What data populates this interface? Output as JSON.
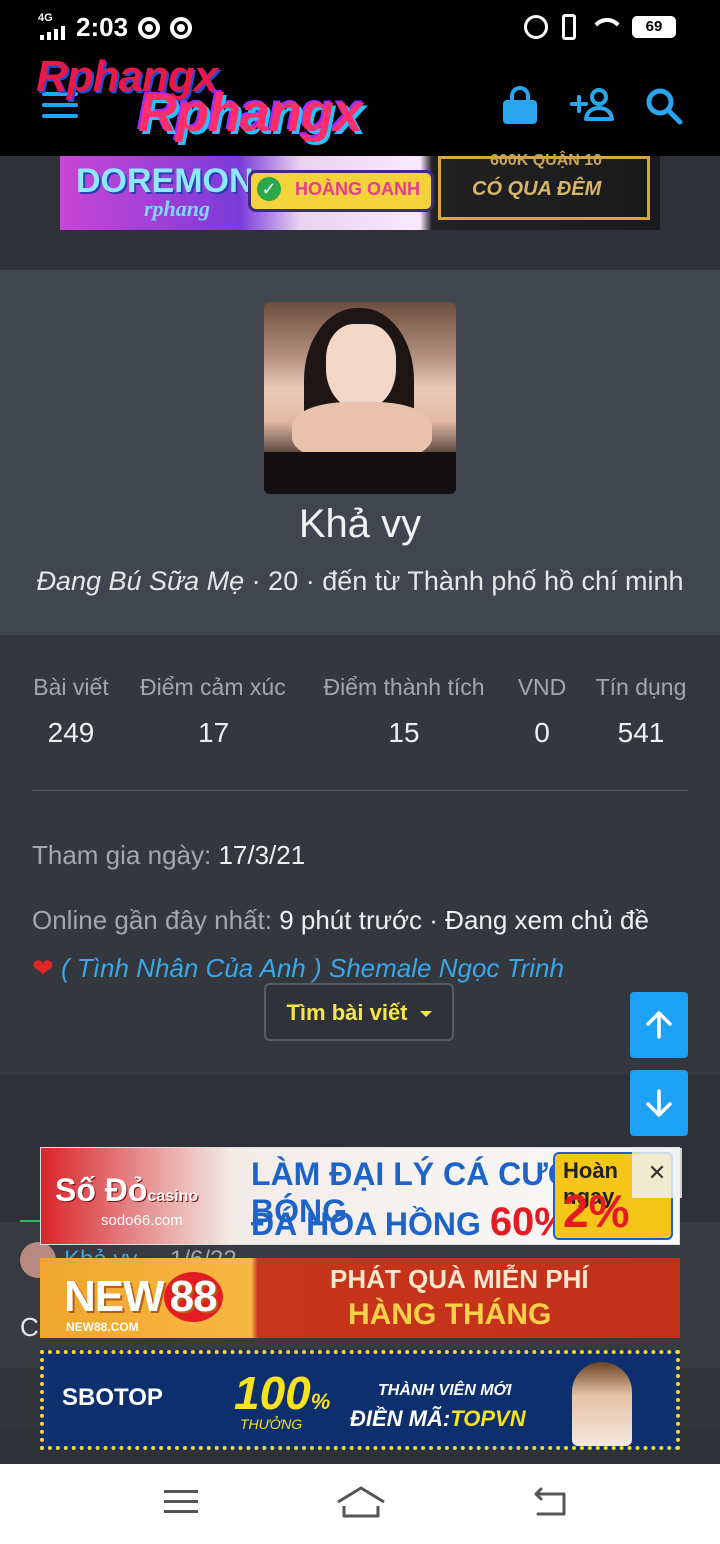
{
  "status_bar": {
    "network": "4G",
    "time": "2:03",
    "battery": "69"
  },
  "header": {
    "logo_text": "Rphangx",
    "logo_suffix": "x"
  },
  "top_banner": {
    "brand": "DOREMON",
    "sub": "rphang",
    "badge": "HOÀNG OANH",
    "line1": "600K QUẬN 10",
    "line2": "CÓ QUA ĐÊM"
  },
  "profile": {
    "name": "Khả vy",
    "title": "Đang Bú Sữa Mẹ",
    "age": "20",
    "location_prefix": "đến từ",
    "location": "Thành phố hồ chí minh"
  },
  "stats": [
    {
      "label": "Bài viết",
      "value": "249"
    },
    {
      "label": "Điểm cảm xúc",
      "value": "17"
    },
    {
      "label": "Điểm thành tích",
      "value": "15"
    },
    {
      "label": "VND",
      "value": "0"
    },
    {
      "label": "Tín dụng",
      "value": "541"
    }
  ],
  "joined": {
    "label": "Tham gia ngày:",
    "value": "17/3/21"
  },
  "last_seen": {
    "label": "Online gần đây nhất:",
    "value": "9 phút trước",
    "activity": "· Đang xem chủ đề",
    "thread_title": "( Tình Nhân Của Anh ) Shemale Ngọc Trinh"
  },
  "find_posts_label": "Tìm bài viết",
  "feed": {
    "author": "Khả vy",
    "date": "1/6/22",
    "snippet": "C"
  },
  "ads": {
    "ad1": {
      "brand": "Số Đỏ",
      "brand_tag": "casino",
      "domain": "sodo66.com",
      "line1": "LÀM ĐẠI LÝ CÁ CƯỢC BÓNG",
      "line2": "ĐÁ HOA HỒNG",
      "pct": "60%",
      "hoan": "Hoàn ngay",
      "hoan_pct": "2%"
    },
    "ad2": {
      "brand": "NEW",
      "brand_num": "88",
      "domain": "NEW88.COM",
      "line1": "PHÁT QUÀ MIỄN PHÍ",
      "line2": "HÀNG THÁNG"
    },
    "ad3": {
      "brand": "SBOTOP",
      "big": "100",
      "big_unit": "%",
      "thuong": "THƯỞNG",
      "m1": "THÀNH VIÊN MỚI",
      "m2": "ĐIỀN MÃ:",
      "code": "TOPVN"
    }
  },
  "colors": {
    "accent": "#1da1f5",
    "link": "#3aa7e8",
    "button_text": "#f6e64a",
    "heart": "#e02525"
  }
}
